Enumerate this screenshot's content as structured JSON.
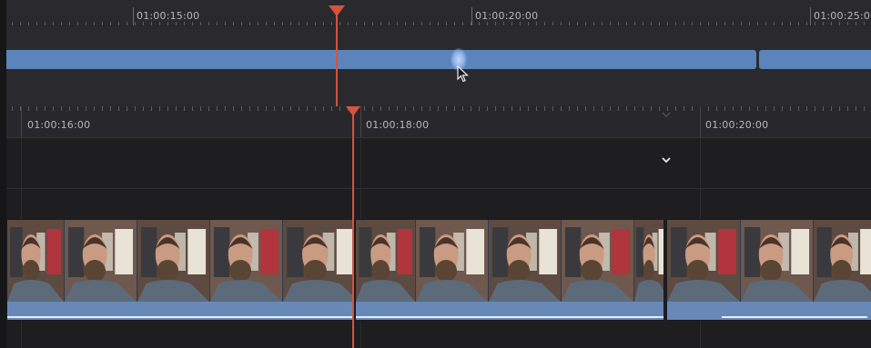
{
  "viewer": {
    "timecodes": [
      "01:00:15:00",
      "01:00:20:00",
      "01:00:25:00"
    ]
  },
  "timeline": {
    "timecodes": [
      "01:00:16:00",
      "01:00:18:00",
      "01:00:20:00"
    ]
  },
  "colors": {
    "playhead": "#d4543f",
    "clip_blue": "#5a84bb",
    "background": "#1c1c1f"
  },
  "icons": {
    "chevron": "chevron-down-icon",
    "cursor": "mouse-cursor-icon",
    "playhead": "playhead-icon"
  }
}
